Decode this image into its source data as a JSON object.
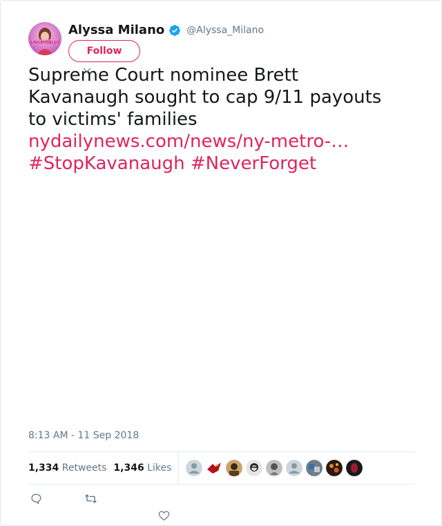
{
  "author": {
    "name": "Alyssa Milano",
    "handle": "@Alyssa_Milano",
    "avatar_text": "UNGAYOBLES",
    "verified_icon": "verified-badge-icon"
  },
  "follow_label": "Follow",
  "tweet": {
    "line1": "Supreme Court nominee Brett",
    "line2": "Kavanaugh sought to cap 9/11 payouts",
    "line3": "to victims' families",
    "link": "nydailynews.com/news/ny-metro-…",
    "hashtag1": "#StopKavanaugh",
    "hashtag2": "#NeverForget"
  },
  "timestamp": "8:13 AM - 11 Sep 2018",
  "stats": {
    "retweets_count": "1,334",
    "retweets_label": "Retweets",
    "likes_count": "1,346",
    "likes_label": "Likes"
  },
  "actions": [
    "reply-icon",
    "retweet-icon",
    "like-icon"
  ],
  "colors": {
    "accent": "#e0245e",
    "muted": "#657786",
    "text": "#14171a",
    "verified": "#1da1f2"
  }
}
